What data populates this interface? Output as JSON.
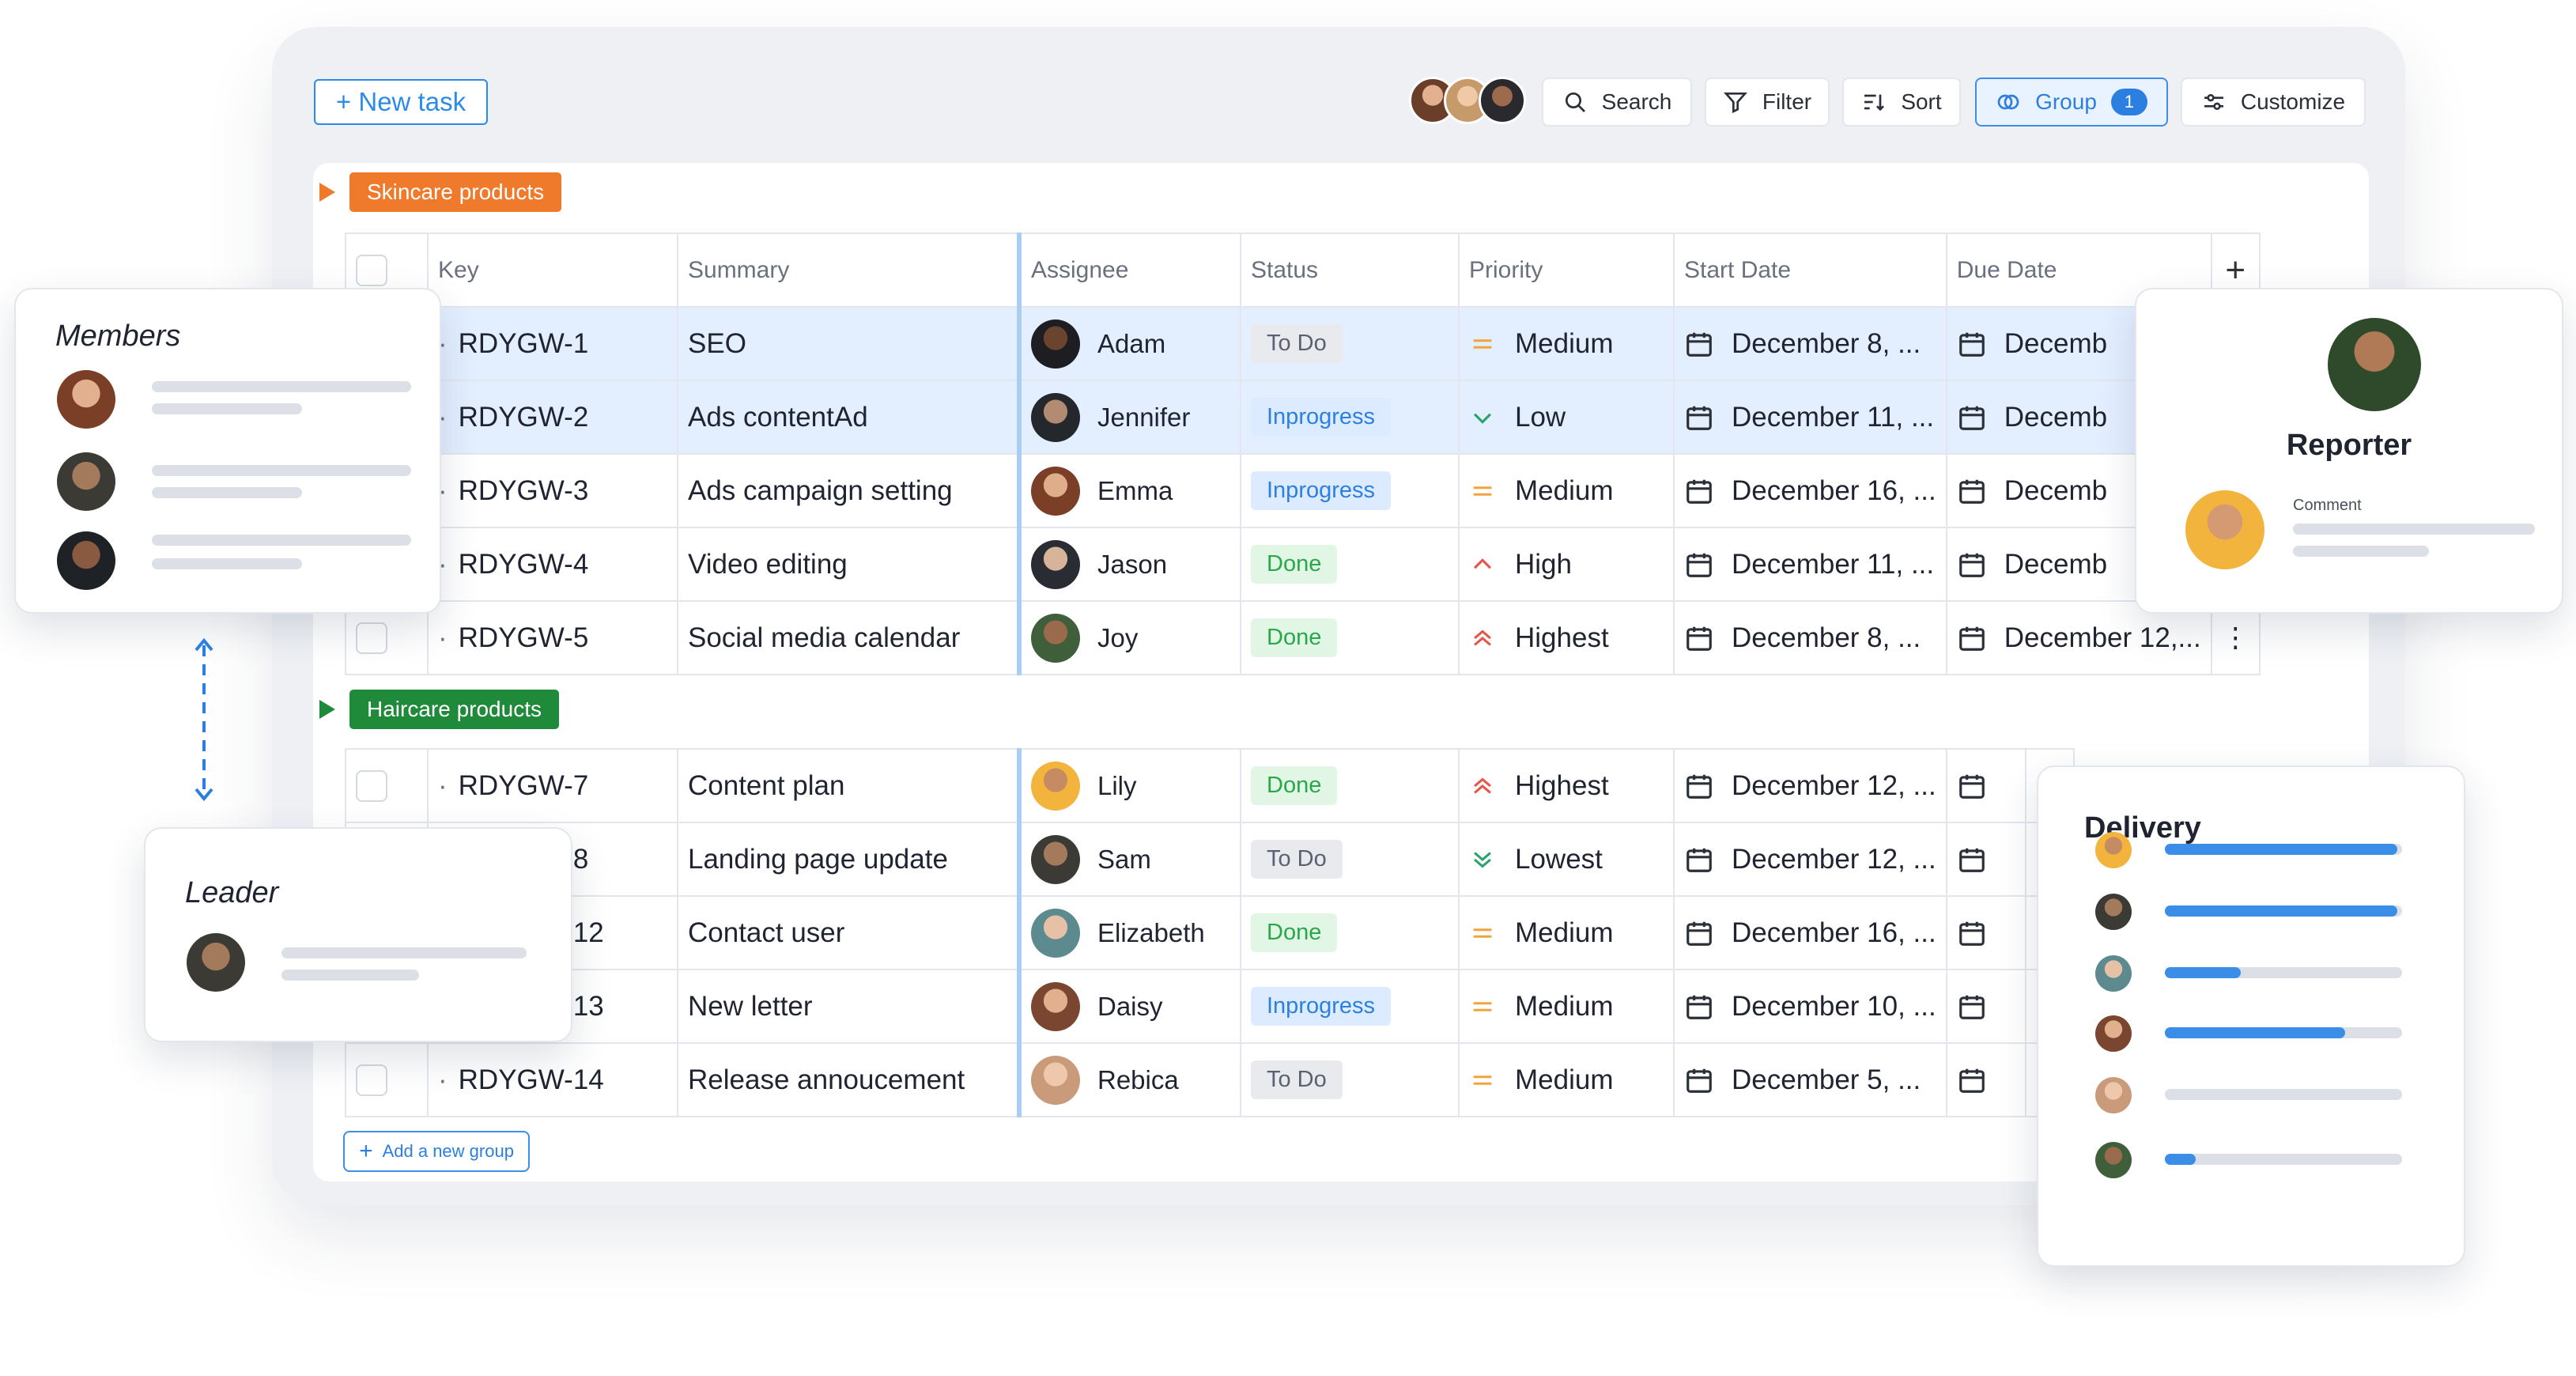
{
  "toolbar": {
    "new_task": "+ New task",
    "search": "Search",
    "filter": "Filter",
    "sort": "Sort",
    "group": "Group",
    "group_count": "1",
    "customize": "Customize"
  },
  "columns": [
    "Key",
    "Summary",
    "Assignee",
    "Status",
    "Priority",
    "Start Date",
    "Due Date"
  ],
  "groups": [
    {
      "name": "Skincare products",
      "color": "#f07a2c",
      "rows": [
        {
          "key": "RDYGW-1",
          "summary": "SEO",
          "assignee": "Adam",
          "status": "To Do",
          "priority": "Medium",
          "start": "December 8, ...",
          "due": "Decemb",
          "selected": true
        },
        {
          "key": "RDYGW-2",
          "summary": "Ads contentAd",
          "assignee": "Jennifer",
          "status": "Inprogress",
          "priority": "Low",
          "start": "December 11, ...",
          "due": "Decemb",
          "selected": true
        },
        {
          "key": "RDYGW-3",
          "summary": "Ads campaign setting",
          "assignee": "Emma",
          "status": "Inprogress",
          "priority": "Medium",
          "start": "December 16, ...",
          "due": "Decemb",
          "selected": false
        },
        {
          "key": "RDYGW-4",
          "summary": "Video editing",
          "assignee": "Jason",
          "status": "Done",
          "priority": "High",
          "start": "December 11, ...",
          "due": "Decemb",
          "selected": false
        },
        {
          "key": "RDYGW-5",
          "summary": "Social media calendar",
          "assignee": "Joy",
          "status": "Done",
          "priority": "Highest",
          "start": "December 8, ...",
          "due": "December 12,...",
          "selected": false
        }
      ]
    },
    {
      "name": "Haircare products",
      "color": "#1f8a3a",
      "rows": [
        {
          "key": "RDYGW-7",
          "summary": "Content plan",
          "assignee": "Lily",
          "status": "Done",
          "priority": "Highest",
          "start": "December 12, ...",
          "due": "",
          "selected": false
        },
        {
          "key": "RDYGW-8",
          "summary": "Landing page update",
          "assignee": "Sam",
          "status": "To Do",
          "priority": "Lowest",
          "start": "December 12, ...",
          "due": "",
          "selected": false
        },
        {
          "key": "RDYGW-12",
          "summary": "Contact user",
          "assignee": "Elizabeth",
          "status": "Done",
          "priority": "Medium",
          "start": "December 16, ...",
          "due": "",
          "selected": false
        },
        {
          "key": "RDYGW-13",
          "summary": "New letter",
          "assignee": "Daisy",
          "status": "Inprogress",
          "priority": "Medium",
          "start": "December 10, ...",
          "due": "",
          "selected": false
        },
        {
          "key": "RDYGW-14",
          "summary": "Release annoucement",
          "assignee": "Rebica",
          "status": "To Do",
          "priority": "Medium",
          "start": "December 5, ...",
          "due": "",
          "selected": false
        }
      ]
    }
  ],
  "add_group": "Add a new group",
  "members_card": {
    "title": "Members"
  },
  "leader_card": {
    "title": "Leader"
  },
  "reporter_card": {
    "title": "Reporter",
    "comment_label": "Comment"
  },
  "delivery_card": {
    "title": "Delivery",
    "progress": [
      0.98,
      0.98,
      0.32,
      0.76,
      0.0,
      0.13
    ]
  },
  "colors": {
    "accent": "#2b7fe0",
    "selected_row": "#e3efff",
    "done": "#29a84a",
    "priority_medium": "#f2a33a",
    "priority_high": "#e8534a",
    "priority_low": "#2aa36b"
  },
  "icons": {
    "search": "search-icon",
    "filter": "filter-icon",
    "sort": "sort-icon",
    "group": "group-icon",
    "customize": "sliders-icon",
    "calendar": "calendar-icon",
    "add_column": "plus-icon",
    "row_menu": "kebab-icon"
  }
}
